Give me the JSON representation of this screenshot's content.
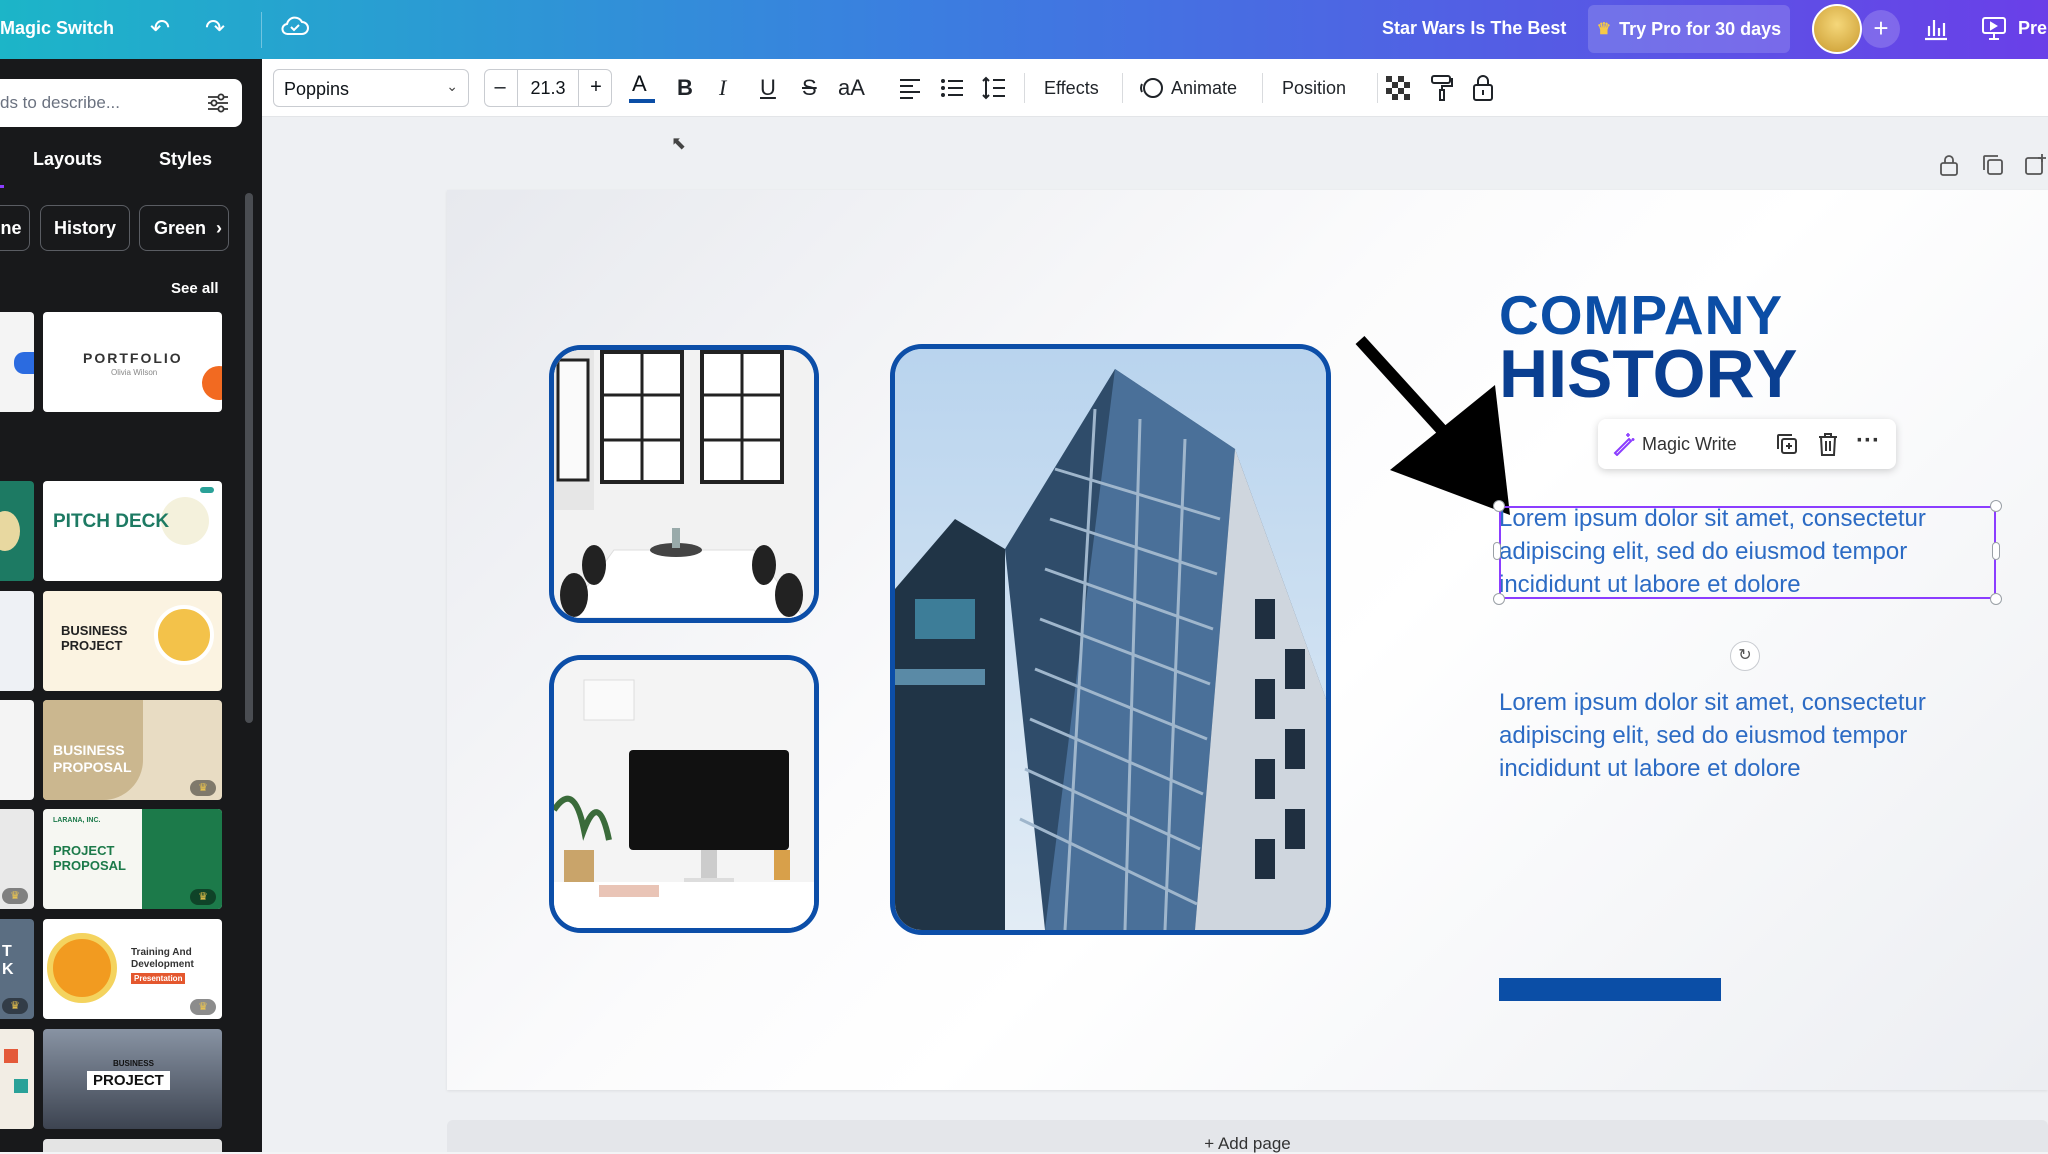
{
  "topbar": {
    "app_name": "Magic Switch",
    "doc_title": "Star Wars Is The Best",
    "pro_label": "Try Pro for 30 days",
    "present_label": "Pre"
  },
  "left_panel": {
    "search_placeholder": "ds to describe...",
    "tabs": [
      "Layouts",
      "Styles"
    ],
    "chips": [
      "ne",
      "History",
      "Green"
    ],
    "see_all": "See all",
    "thumbnails": [
      {
        "title": "PORTFOLIO",
        "subtitle": "Olivia Wilson"
      },
      {
        "title": "PITCH DECK"
      },
      {
        "title": "BUSINESS PROJECT"
      },
      {
        "title": "BUSINESS PROPOSAL"
      },
      {
        "title": "PROJECT PROPOSAL",
        "subtitle": "LARANA, INC."
      },
      {
        "title": "Training And Development",
        "subtitle": "Presentation"
      },
      {
        "title": "PROJECT",
        "subtitle": "BUSINESS"
      }
    ],
    "strip_text": "T K"
  },
  "toolbar": {
    "font": "Poppins",
    "font_size": "21.3",
    "effects_label": "Effects",
    "animate_label": "Animate",
    "position_label": "Position"
  },
  "slide": {
    "title_line1": "COMPANY",
    "title_line2": "HISTORY",
    "paragraph1": "Lorem ipsum dolor sit amet, consectetur adipiscing elit, sed do eiusmod tempor incididunt ut labore et dolore",
    "paragraph2": "Lorem ipsum dolor sit amet, consectetur adipiscing elit, sed do eiusmod tempor incididunt ut labore et dolore"
  },
  "context_bar": {
    "magic_write_label": "Magic Write"
  },
  "footer": {
    "add_page_label": "+ Add page"
  },
  "colors": {
    "brand_blue": "#0b4ea6",
    "selection_purple": "#8b3dff"
  }
}
